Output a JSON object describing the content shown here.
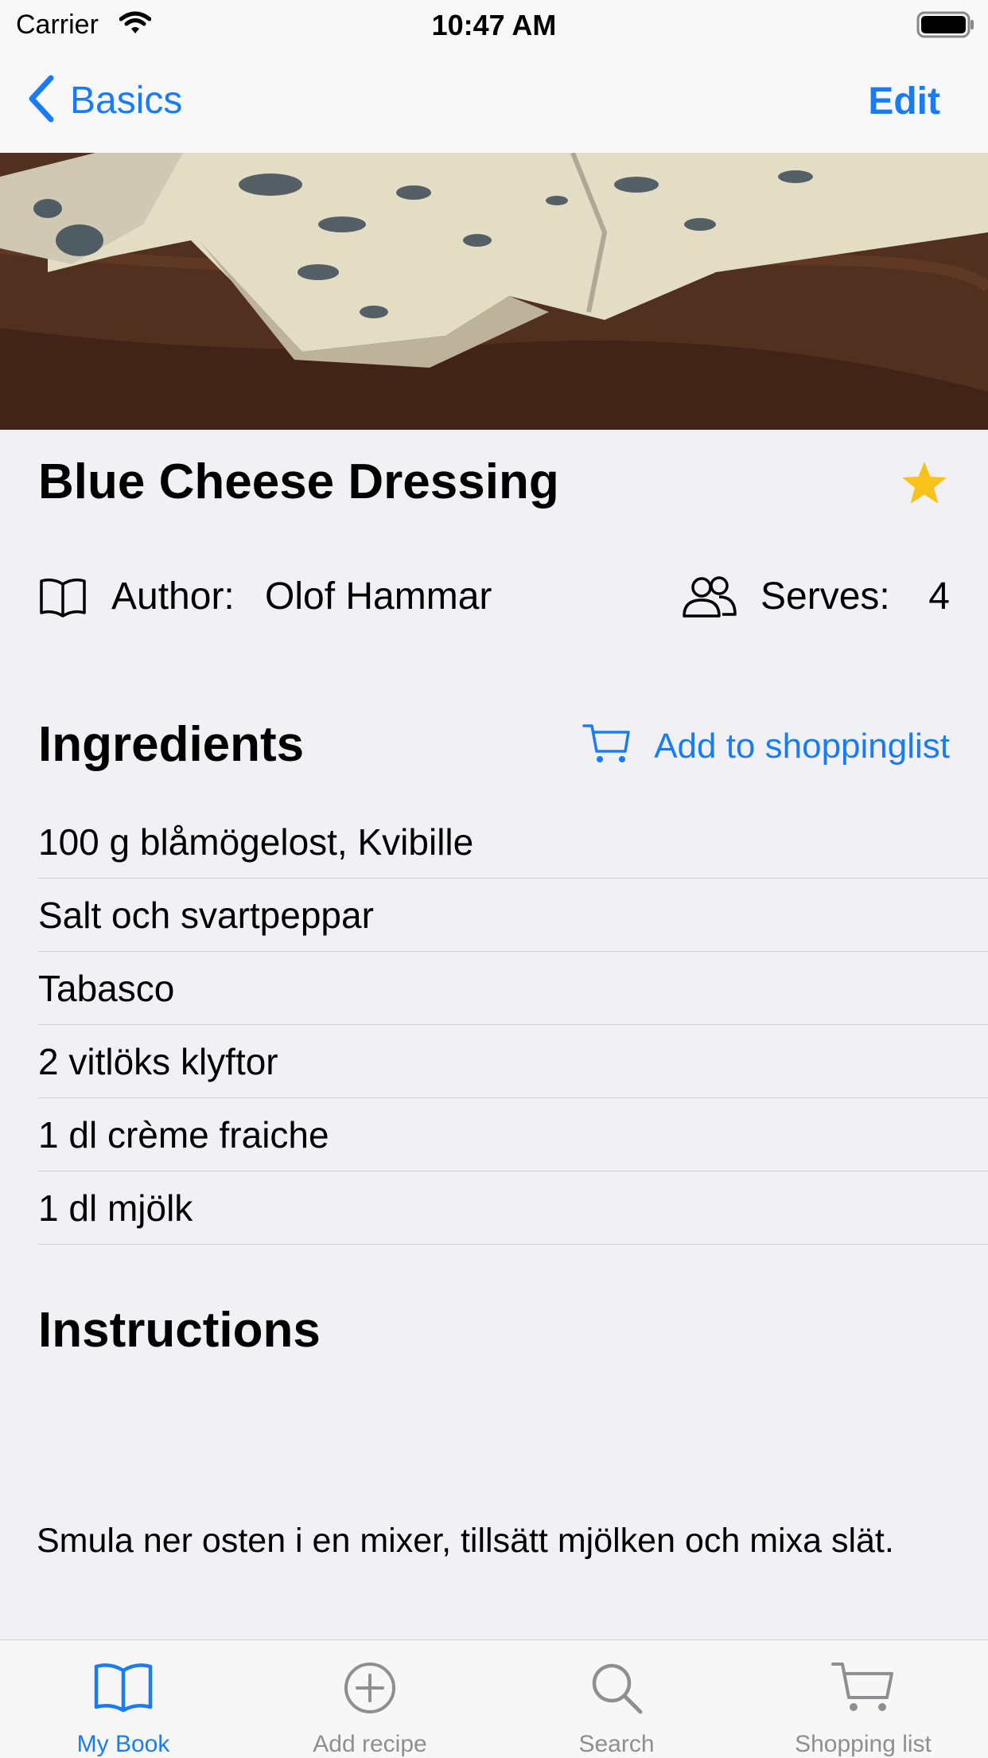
{
  "status_bar": {
    "carrier": "Carrier",
    "time": "10:47 AM"
  },
  "nav": {
    "back_label": "Basics",
    "edit_label": "Edit"
  },
  "recipe": {
    "title": "Blue Cheese Dressing",
    "author_label": "Author:",
    "author": "Olof Hammar",
    "serves_label": "Serves:",
    "serves": "4",
    "favorite": true
  },
  "ingredients": {
    "heading": "Ingredients",
    "add_to_list_label": "Add to shoppinglist",
    "items": [
      "100 g blåmögelost, Kvibille",
      "Salt och svartpeppar",
      "Tabasco",
      "2 vitlöks klyftor",
      "1 dl crème fraiche",
      "1 dl mjölk"
    ]
  },
  "instructions": {
    "heading": "Instructions",
    "text": "Smula ner osten i en mixer, tillsätt mjölken och mixa slät."
  },
  "tabs": [
    {
      "label": "My Book",
      "icon": "book-icon",
      "active": true
    },
    {
      "label": "Add recipe",
      "icon": "plus-circle-icon",
      "active": false
    },
    {
      "label": "Search",
      "icon": "search-icon",
      "active": false
    },
    {
      "label": "Shopping list",
      "icon": "cart-icon",
      "active": false
    }
  ],
  "colors": {
    "accent": "#1a7cf5",
    "star": "#f7c21a",
    "background": "#f1f1f5",
    "inactive_tab": "#8e8e93"
  }
}
